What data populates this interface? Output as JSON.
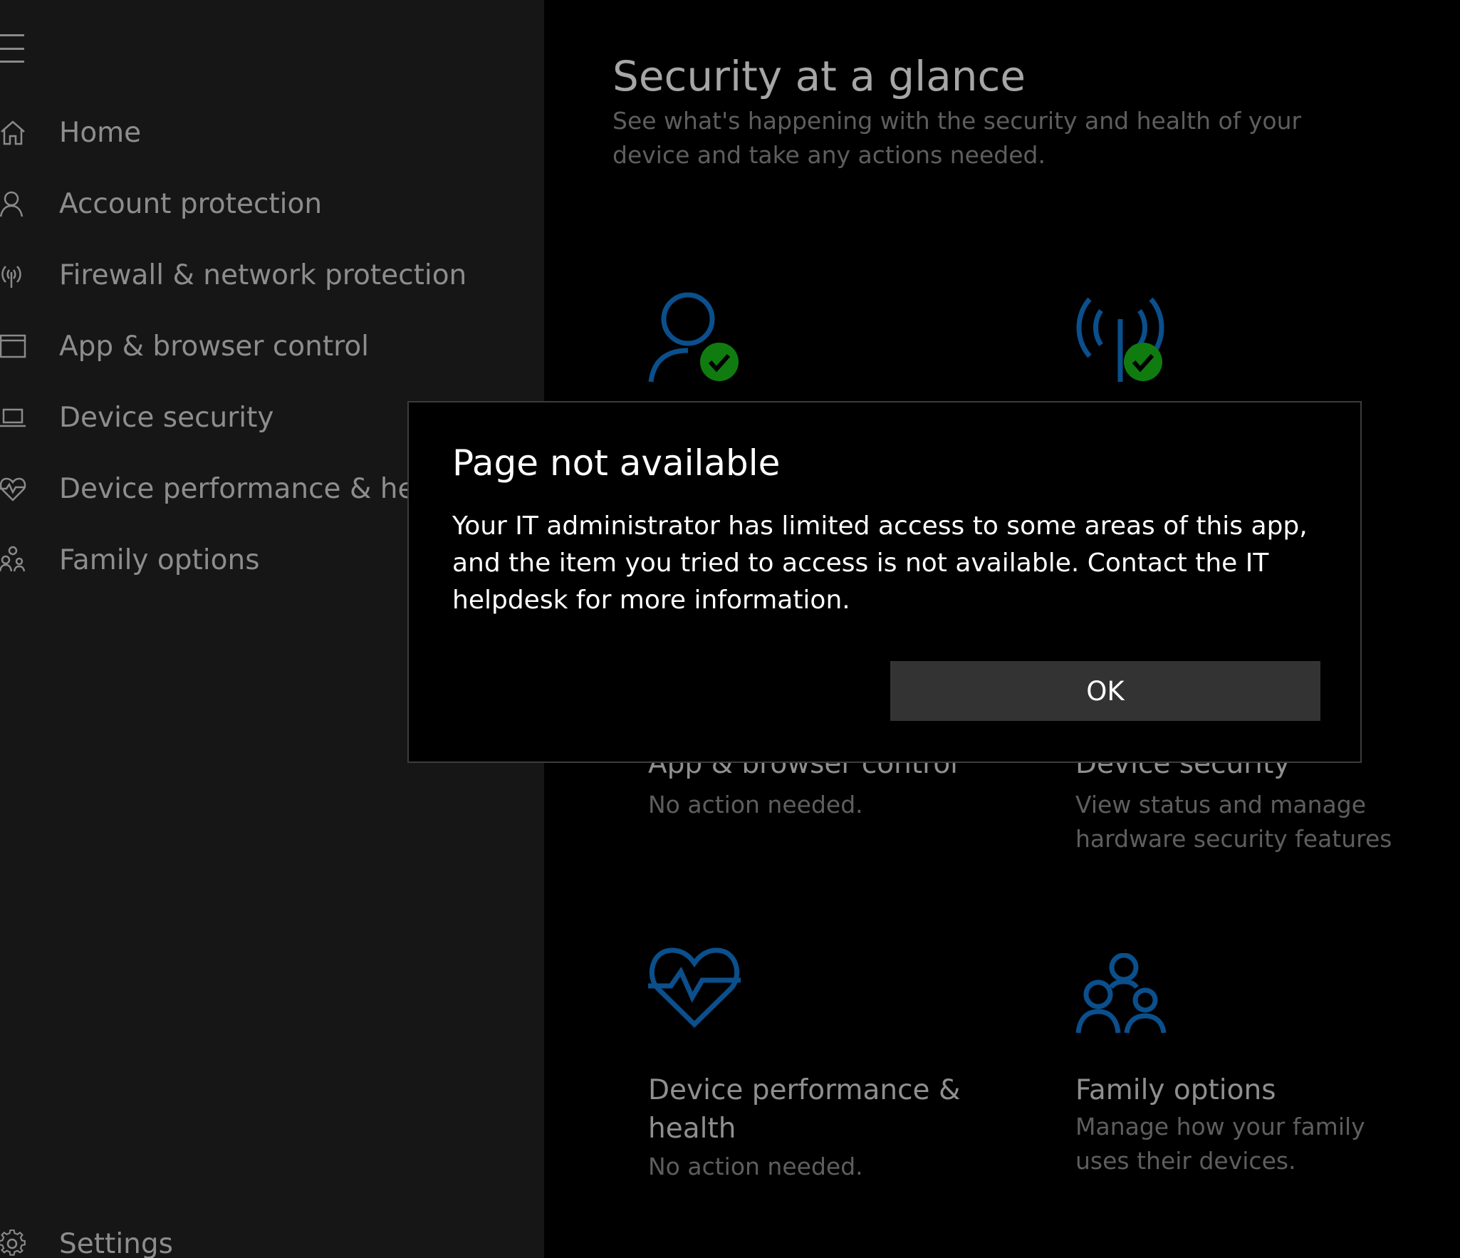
{
  "sidebar": {
    "items": [
      {
        "label": "Home",
        "icon": "home-icon"
      },
      {
        "label": "Account protection",
        "icon": "person-icon"
      },
      {
        "label": "Firewall & network protection",
        "icon": "antenna-icon"
      },
      {
        "label": "App & browser control",
        "icon": "browser-window-icon"
      },
      {
        "label": "Device security",
        "icon": "laptop-icon"
      },
      {
        "label": "Device performance & health",
        "icon": "heart-pulse-icon"
      },
      {
        "label": "Family options",
        "icon": "family-icon"
      }
    ],
    "settings_label": "Settings"
  },
  "main": {
    "title": "Security at a glance",
    "subtitle": "See what's happening with the security and health of your device and take any actions needed.",
    "tiles": [
      {
        "title": "App & browser control",
        "desc": "No action needed."
      },
      {
        "title": "Device security",
        "desc": "View status and manage hardware security features"
      },
      {
        "title": "Device performance & health",
        "desc": "No action needed."
      },
      {
        "title": "Family options",
        "desc": "Manage how your family uses their devices."
      }
    ]
  },
  "dialog": {
    "title": "Page not available",
    "body": "Your IT administrator has limited access to some areas of this app, and the item you tried to access is not available. Contact the IT helpdesk for more information.",
    "ok_label": "OK"
  },
  "colors": {
    "accent_blue": "#0b4f8c",
    "check_green": "#107c10"
  }
}
